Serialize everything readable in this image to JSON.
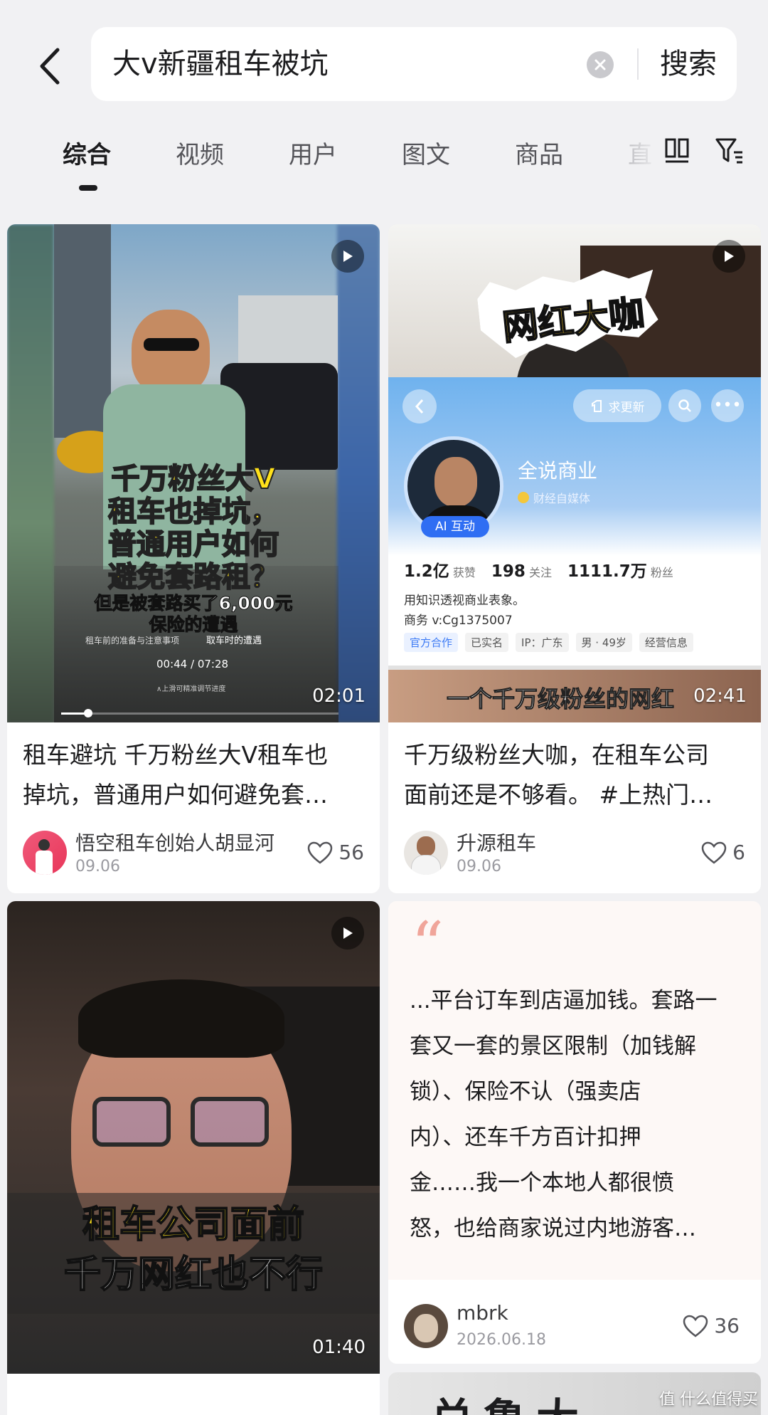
{
  "header": {
    "search_query": "大v新疆租车被坑",
    "search_button": "搜索"
  },
  "tabs": [
    {
      "label": "综合",
      "active": true
    },
    {
      "label": "视频"
    },
    {
      "label": "用户"
    },
    {
      "label": "图文"
    },
    {
      "label": "商品"
    },
    {
      "label": "直"
    }
  ],
  "cards": [
    {
      "type": "video",
      "duration": "02:01",
      "overlay": {
        "headline": [
          "千万粉丝大V",
          "租车也掉坑，",
          "普通用户如何",
          "避免套路租？"
        ],
        "subline": [
          "但是被套路买了6,000元",
          "保险的遭遇"
        ],
        "player_time": "00:44 / 07:28",
        "hint_left": "租车前的准备与注意事项",
        "hint_right": "取车时的遭遇",
        "hint_bottom": "∧上滑可精准调节进度"
      },
      "title_lines": [
        "租车避坑 千万粉丝大V租车也",
        "掉坑，普通用户如何避免套…"
      ],
      "author": "悟空租车创始人胡显河",
      "date": "09.06",
      "likes": "56"
    },
    {
      "type": "video",
      "duration": "02:41",
      "overlay": {
        "badge": "网红大咖",
        "profile_name": "全说商业",
        "profile_verified": "财经自媒体",
        "ai_tag": "AI 互动",
        "request_update": "求更新",
        "stats": [
          {
            "value": "1.2亿",
            "label": "获赞"
          },
          {
            "value": "198",
            "label": "关注"
          },
          {
            "value": "1111.7万",
            "label": "粉丝"
          }
        ],
        "bio": "用知识透视商业表象。",
        "contact": "商务 v:Cg1375007",
        "tags": [
          "官方合作",
          "已实名",
          "IP：广东",
          "男 · 49岁",
          "经营信息"
        ],
        "subtitle": "一个千万级粉丝的网红"
      },
      "title_lines": [
        "千万级粉丝大咖，在租车公司",
        "面前还是不够看。 #上热门…"
      ],
      "author": "升源租车",
      "date": "09.06",
      "likes": "6"
    },
    {
      "type": "video",
      "duration": "01:40",
      "overlay": {
        "caption": [
          "租车公司面前",
          "千万网红也不行"
        ]
      }
    },
    {
      "type": "note",
      "quote_mark": "“",
      "text_lines": [
        "...平台订车到店逼加钱。套路一",
        "套又一套的景区限制（加钱解",
        "锁）、保险不认（强卖店",
        "内）、还车千方百计扣押",
        "金……我一个本地人都很愤",
        "怒，也给商家说过内地游客…"
      ],
      "author": "mbrk",
      "date": "2026.06.18",
      "likes": "36"
    },
    {
      "type": "video",
      "overlay": {
        "caption": "兑鲁大"
      }
    }
  ],
  "watermark": "值 什么值得买",
  "colors": {
    "background": "#f1f1f3",
    "card": "#ffffff",
    "tag_blue": "#3d7bf5",
    "caption_yellow": "#ffe11a",
    "quote_red": "#f0a59a"
  }
}
